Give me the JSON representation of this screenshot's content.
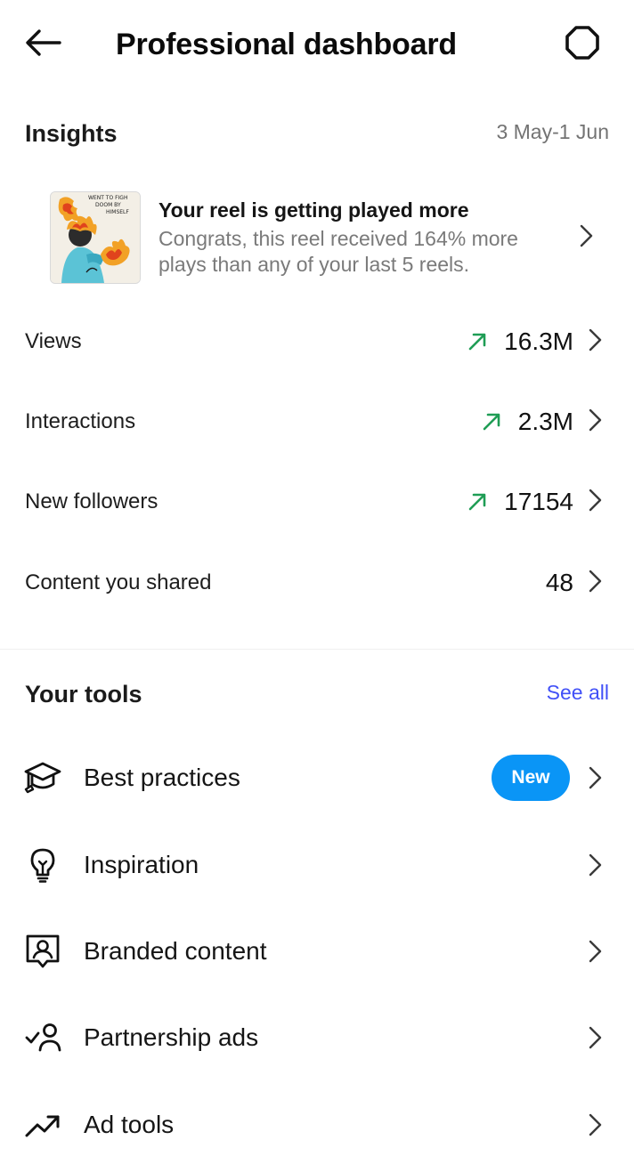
{
  "header": {
    "title": "Professional dashboard",
    "back_icon": "arrow-left-icon",
    "settings_icon": "gear-icon"
  },
  "insights": {
    "title": "Insights",
    "date_range": "3 May-1 Jun",
    "reel_card": {
      "title": "Your reel is getting played more",
      "description": "Congrats, this reel received 164% more plays than any of your last 5 reels.",
      "thumbnail_caption": "WENT TO FIGHT DOOM BY HIMSELF"
    },
    "metrics": [
      {
        "label": "Views",
        "value": "16.3M",
        "trend": "up"
      },
      {
        "label": "Interactions",
        "value": "2.3M",
        "trend": "up"
      },
      {
        "label": "New followers",
        "value": "17154",
        "trend": "up"
      },
      {
        "label": "Content you shared",
        "value": "48",
        "trend": "none"
      }
    ]
  },
  "tools": {
    "title": "Your tools",
    "see_all": "See all",
    "items": [
      {
        "label": "Best practices",
        "icon": "graduation-cap-icon",
        "badge": "New"
      },
      {
        "label": "Inspiration",
        "icon": "lightbulb-icon"
      },
      {
        "label": "Branded content",
        "icon": "branded-content-icon"
      },
      {
        "label": "Partnership ads",
        "icon": "partnership-ads-icon"
      },
      {
        "label": "Ad tools",
        "icon": "trending-up-icon"
      }
    ]
  },
  "colors": {
    "accent_blue": "#4150f7",
    "badge_blue": "#0a95f6",
    "trend_green": "#1f9d55",
    "secondary_text": "#737373"
  }
}
